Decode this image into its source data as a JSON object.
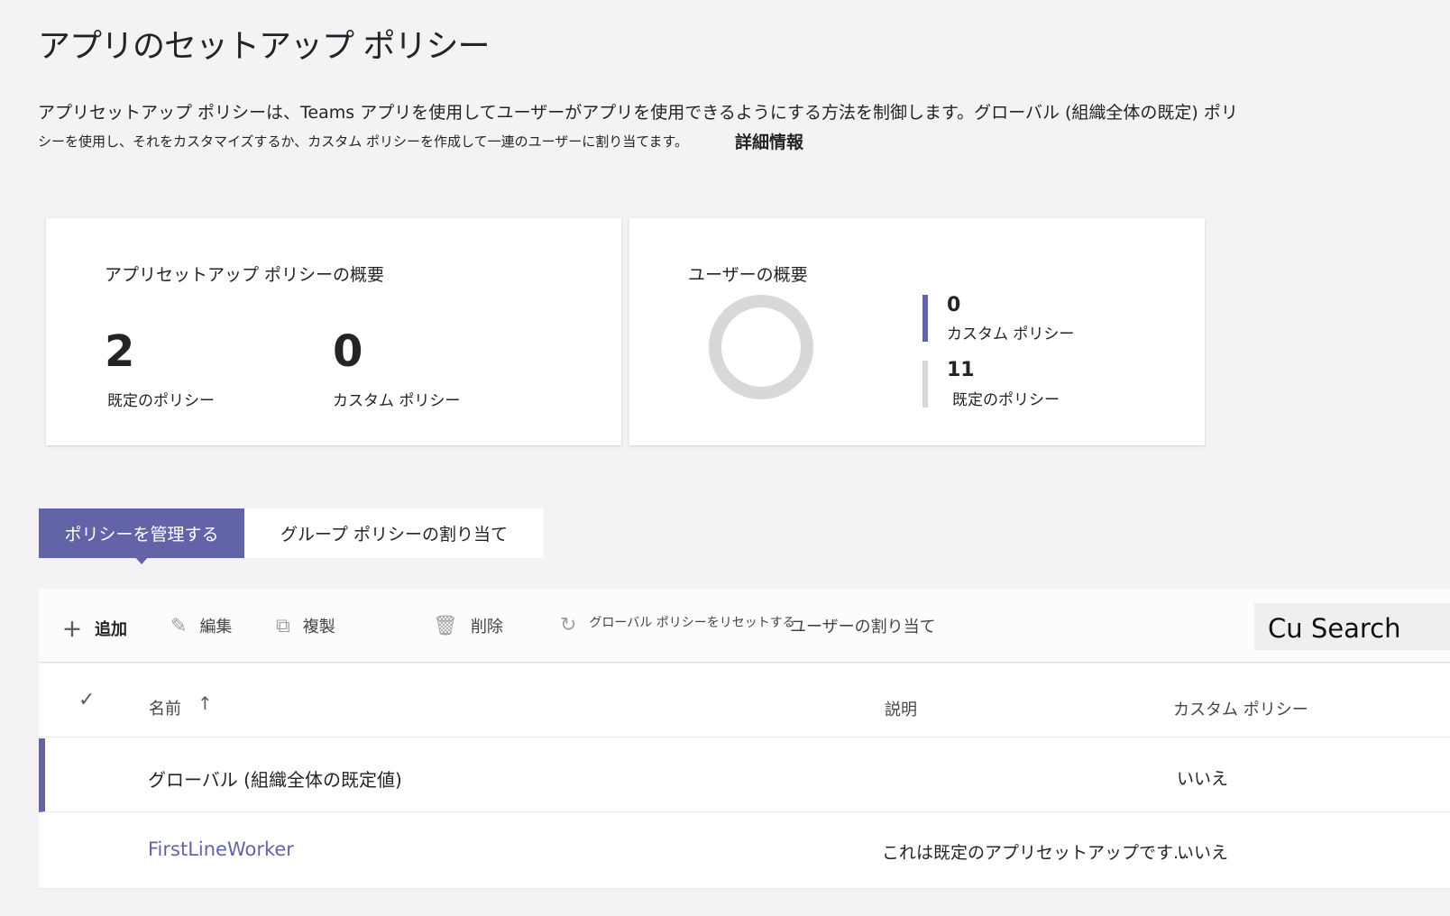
{
  "title": "アプリのセットアップ ポリシー",
  "description_line1": "アプリセットアップ ポリシーは、Teams アプリを使用してユーザーがアプリを使用できるようにする方法を制御します。グローバル (組織全体の既定) ポリ",
  "description_line2": "シーを使用し、それをカスタマイズするか、カスタム ポリシーを作成して一連のユーザーに割り当てます。",
  "learn_more": "詳細情報",
  "policy_summary": {
    "title": "アプリセットアップ ポリシーの概要",
    "default_count": "2",
    "default_label": "既定のポリシー",
    "custom_count": "0",
    "custom_label": "カスタム ポリシー"
  },
  "user_summary": {
    "title": "ユーザーの概要",
    "custom_count": "0",
    "custom_label": "カスタム ポリシー",
    "default_count": "11",
    "default_label": "既定のポリシー",
    "custom_color": "#6264a7",
    "default_color": "#d2d0ce"
  },
  "tabs": [
    {
      "label": "ポリシーを管理する",
      "active": true
    },
    {
      "label": "グループ ポリシーの割り当て",
      "active": false
    }
  ],
  "toolbar": {
    "add": "追加",
    "edit": "編集",
    "duplicate": "複製",
    "delete": "削除",
    "reset": "グローバル ポリシーをリセットする",
    "assign": "ユーザーの割り当て",
    "search": "Cu Search"
  },
  "table": {
    "headers": {
      "name": "名前",
      "description": "説明",
      "custom": "カスタム ポリシー"
    },
    "rows": [
      {
        "name": "グローバル (組織全体の既定値)",
        "description": "",
        "custom": "いいえ"
      },
      {
        "name": "FirstLineWorker",
        "description": "これは既定のアプリセットアップです...",
        "custom": "いいえ"
      }
    ]
  },
  "accent": "#6264a7"
}
